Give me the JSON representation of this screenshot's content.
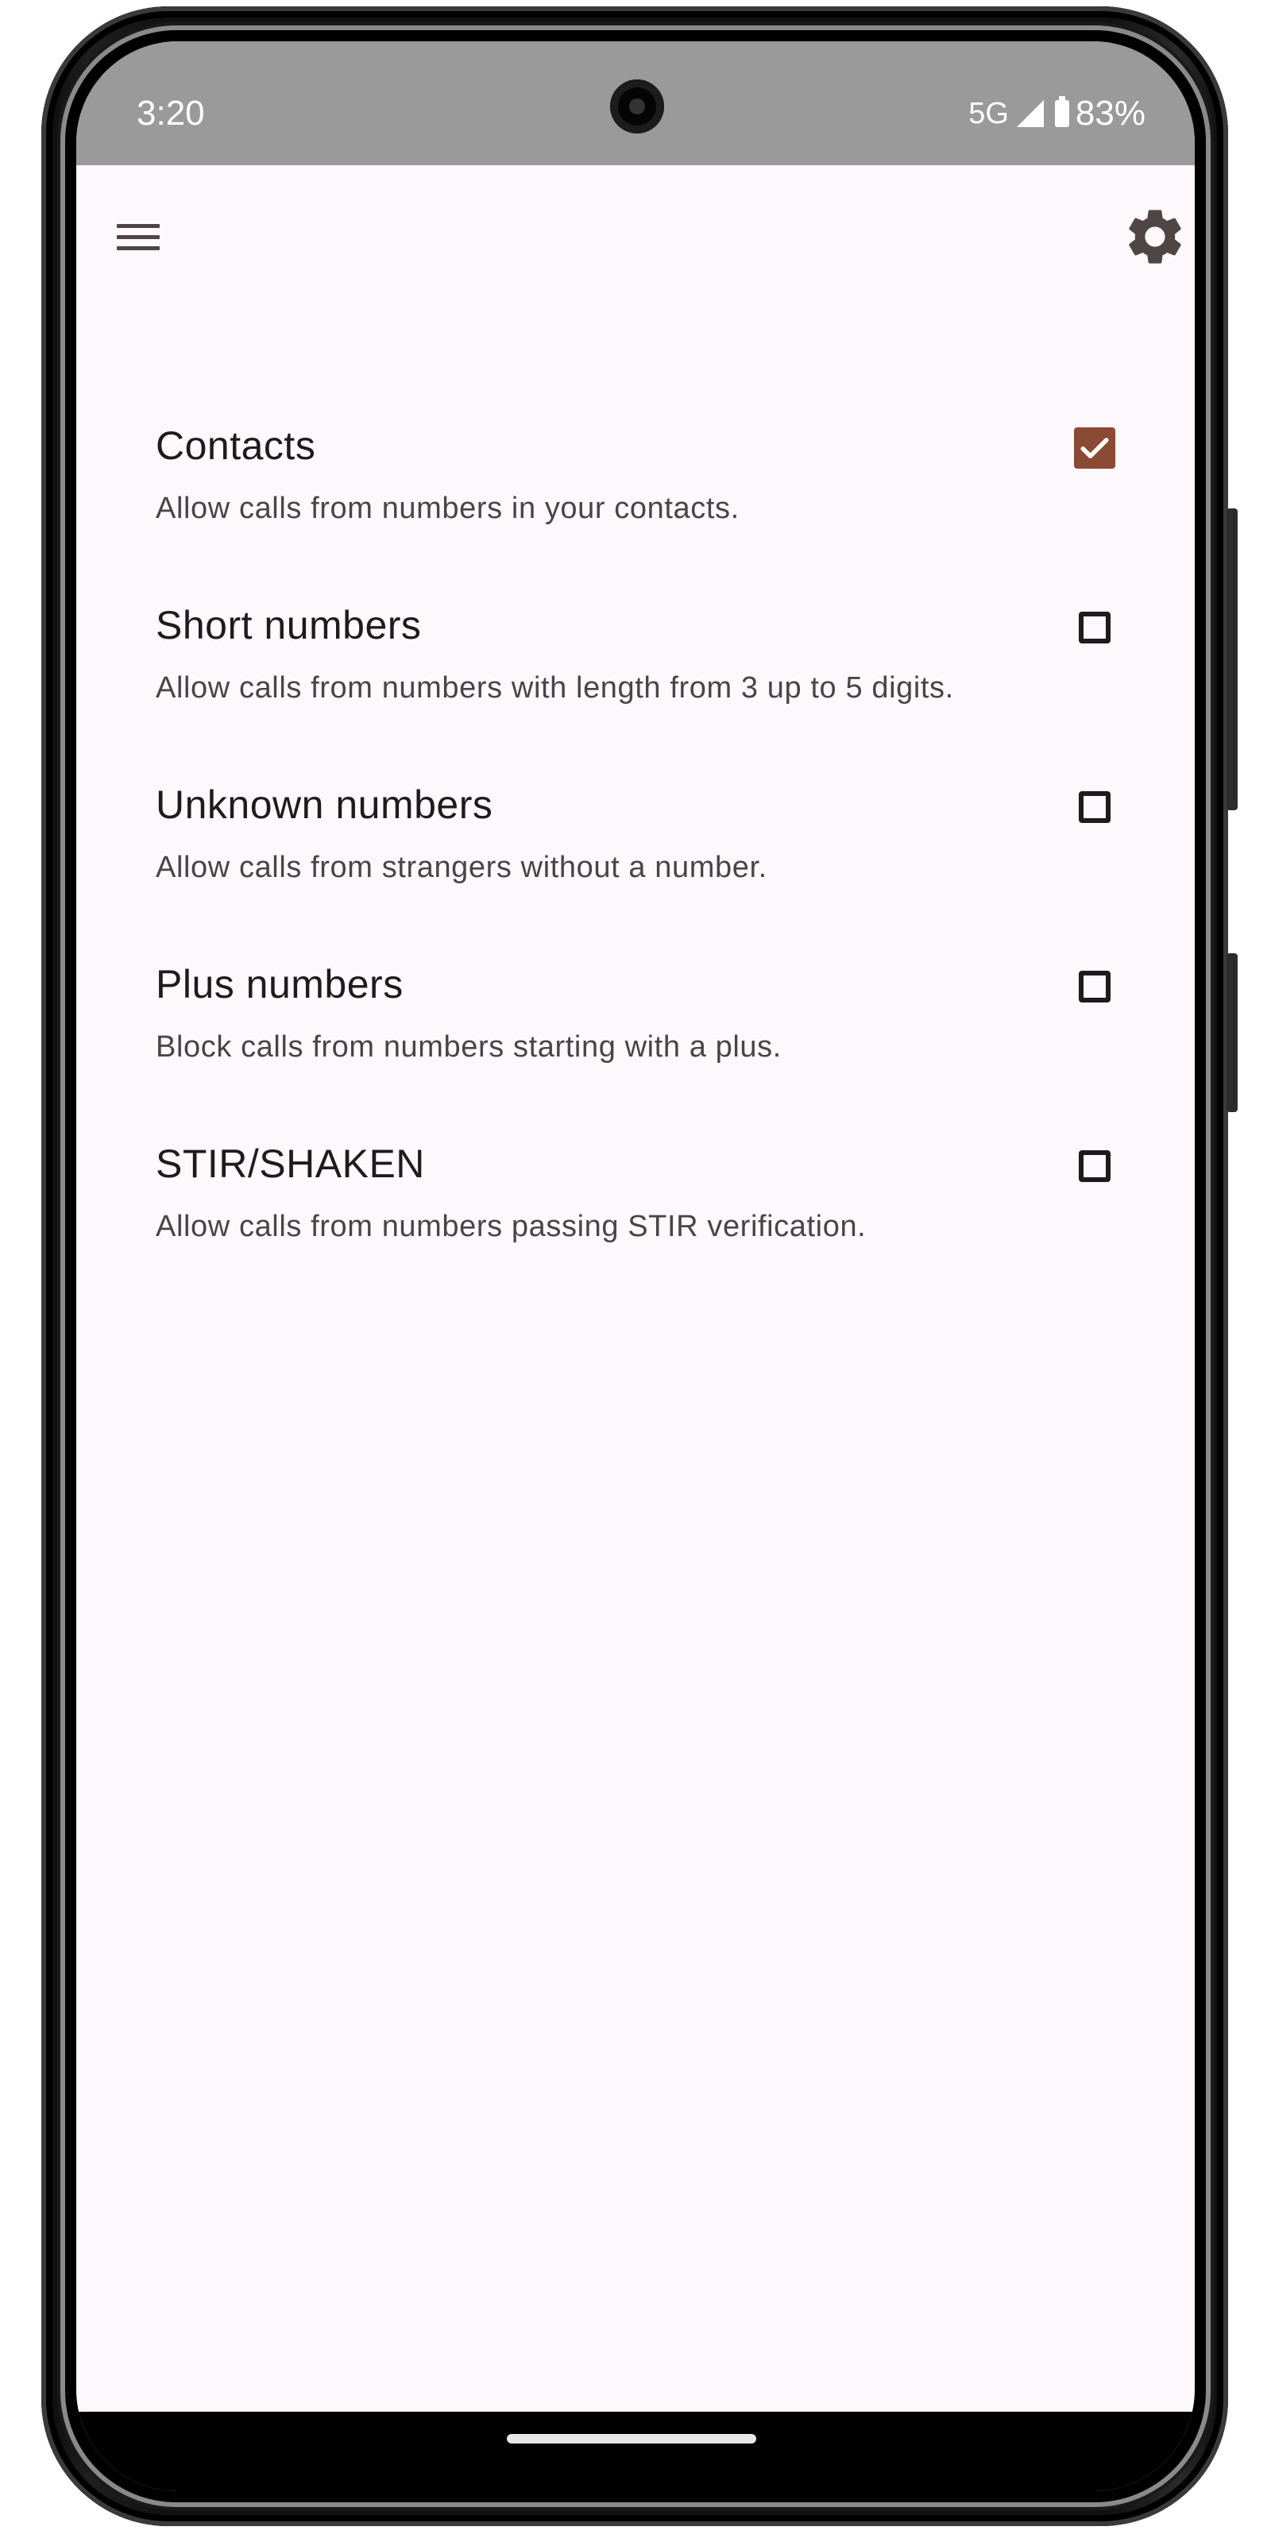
{
  "status_bar": {
    "time": "3:20",
    "network": "5G",
    "battery": "83%"
  },
  "app_bar": {
    "menu_icon": "hamburger-menu-icon",
    "settings_icon": "gear-icon"
  },
  "settings": [
    {
      "title": "Contacts",
      "description": "Allow calls from numbers in your contacts.",
      "checked": true
    },
    {
      "title": "Short numbers",
      "description": "Allow calls from numbers with length from 3 up to 5 digits.",
      "checked": false
    },
    {
      "title": "Unknown numbers",
      "description": "Allow calls from strangers without a number.",
      "checked": false
    },
    {
      "title": "Plus numbers",
      "description": "Block calls from numbers starting with a plus.",
      "checked": false
    },
    {
      "title": "STIR/SHAKEN",
      "description": "Allow calls from numbers passing STIR verification.",
      "checked": false
    }
  ],
  "colors": {
    "accent": "#8b4a33",
    "surface": "#fdf8fb",
    "status_bar": "#9a9a9a",
    "on_surface": "#1f1a1c",
    "on_surface_variant": "#4a4446",
    "icon": "#4f4544"
  }
}
